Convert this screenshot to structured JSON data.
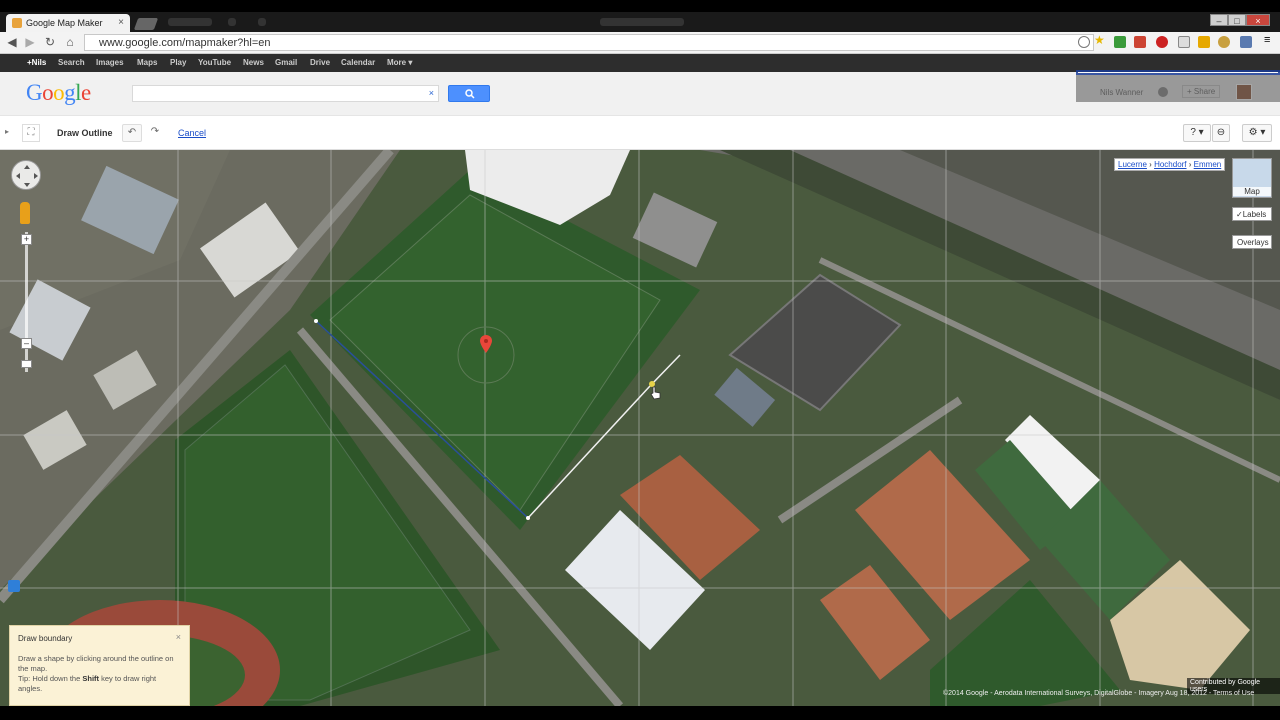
{
  "browser": {
    "tabs": [
      {
        "label": "Google Map Maker",
        "active": true
      },
      {
        "label": "",
        "active": false
      }
    ],
    "close_glyph": "×",
    "window_controls": [
      "–",
      "□",
      "×"
    ],
    "url": "www.google.com/mapmaker?hl=en",
    "icons": [
      "back-icon",
      "forward-icon",
      "reload-icon",
      "home-icon",
      "page-icon",
      "zoom-icon",
      "bookmark-star-icon"
    ]
  },
  "gbar": {
    "items": [
      "+Nils",
      "Search",
      "Images",
      "Maps",
      "Play",
      "YouTube",
      "News",
      "Gmail",
      "Drive",
      "Calendar",
      "More ▾"
    ]
  },
  "header": {
    "logo_letters": [
      "G",
      "o",
      "o",
      "g",
      "l",
      "e"
    ],
    "search_value": "",
    "search_clear": "×",
    "user_name": "Nils Wanner",
    "share_label": "+ Share"
  },
  "toolbar": {
    "title": "Draw Outline",
    "undo": "↶",
    "redo": "↷",
    "cancel": "Cancel",
    "help": "? ▾",
    "link": "⊖",
    "settings": "⚙ ▾"
  },
  "map": {
    "breadcrumb": [
      "Lucerne",
      "Hochdorf",
      "Emmen"
    ],
    "breadcrumb_sep": "›",
    "thumb_label": "Map",
    "labels_toggle": "✓Labels",
    "overlays": "Overlays",
    "zoom_in": "+",
    "zoom_out": "–",
    "contributed": "Contributed by Google users",
    "copyright": "©2014 Google - Aerodata International Surveys, DigitalGlobe - Imagery Aug 18, 2012 - Terms of Use",
    "accent_pin": "#e8463a",
    "outline_color": "#2a4f9a"
  },
  "hint": {
    "title": "Draw boundary",
    "close": "×",
    "line1": "Draw a shape by clicking around the outline on the map.",
    "tip_prefix": "Tip:",
    "tip_middle": " Hold down the ",
    "tip_key": "Shift",
    "tip_suffix": " key to draw right angles."
  }
}
